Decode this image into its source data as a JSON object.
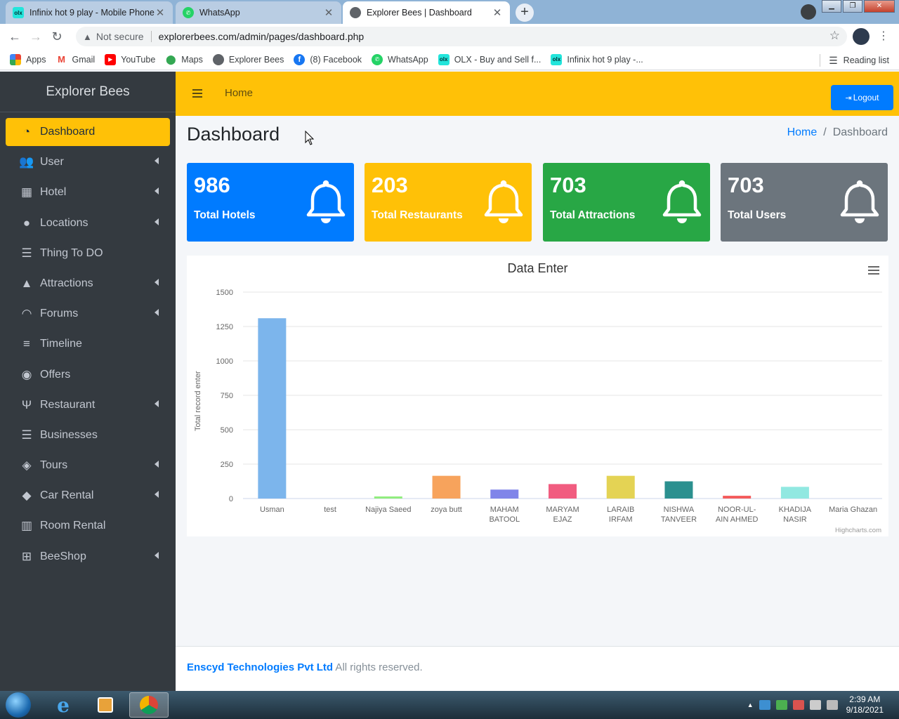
{
  "browser": {
    "tabs": [
      {
        "title": "Infinix hot 9 play - Mobile Phone",
        "favicon": "olx-icon"
      },
      {
        "title": "WhatsApp",
        "favicon": "whatsapp-icon"
      },
      {
        "title": "Explorer Bees | Dashboard",
        "favicon": "globe-icon"
      }
    ],
    "address": {
      "security": "Not secure",
      "url": "explorerbees.com/admin/pages/dashboard.php"
    },
    "bookmarks": [
      {
        "label": "Apps",
        "icon": "apps-grid-icon"
      },
      {
        "label": "Gmail",
        "icon": "gmail-icon"
      },
      {
        "label": "YouTube",
        "icon": "youtube-icon"
      },
      {
        "label": "Maps",
        "icon": "maps-icon"
      },
      {
        "label": "Explorer Bees",
        "icon": "globe-icon"
      },
      {
        "label": "(8) Facebook",
        "icon": "facebook-icon"
      },
      {
        "label": "WhatsApp",
        "icon": "whatsapp-icon"
      },
      {
        "label": "OLX - Buy and Sell f...",
        "icon": "olx-icon"
      },
      {
        "label": "Infinix hot 9 play -...",
        "icon": "olx-icon"
      }
    ],
    "reading_list": "Reading list"
  },
  "sidebar": {
    "brand": "Explorer Bees",
    "items": [
      {
        "label": "Dashboard",
        "icon": "dashboard-icon",
        "active": true
      },
      {
        "label": "User",
        "icon": "users-icon",
        "submenu": true
      },
      {
        "label": "Hotel",
        "icon": "hotel-icon",
        "submenu": true
      },
      {
        "label": "Locations",
        "icon": "map-marker-icon",
        "submenu": true
      },
      {
        "label": "Thing To DO",
        "icon": "list-icon"
      },
      {
        "label": "Attractions",
        "icon": "mountain-icon",
        "submenu": true
      },
      {
        "label": "Forums",
        "icon": "forum-icon",
        "submenu": true
      },
      {
        "label": "Timeline",
        "icon": "timeline-icon"
      },
      {
        "label": "Offers",
        "icon": "offers-icon"
      },
      {
        "label": "Restaurant",
        "icon": "utensils-icon",
        "submenu": true
      },
      {
        "label": "Businesses",
        "icon": "list-icon"
      },
      {
        "label": "Tours",
        "icon": "tours-icon",
        "submenu": true
      },
      {
        "label": "Car Rental",
        "icon": "car-icon",
        "submenu": true
      },
      {
        "label": "Room Rental",
        "icon": "building-icon"
      },
      {
        "label": "BeeShop",
        "icon": "cart-icon",
        "submenu": true
      }
    ]
  },
  "topnav": {
    "home": "Home",
    "logout": "Logout"
  },
  "page": {
    "title": "Dashboard",
    "breadcrumb": {
      "home": "Home",
      "current": "Dashboard"
    }
  },
  "stats": [
    {
      "value": "986",
      "label": "Total Hotels",
      "color": "#007bff"
    },
    {
      "value": "203",
      "label": "Total Restaurants",
      "color": "#ffc107"
    },
    {
      "value": "703",
      "label": "Total Attractions",
      "color": "#28a745"
    },
    {
      "value": "703",
      "label": "Total Users",
      "color": "#6c757d"
    }
  ],
  "chart_data": {
    "type": "bar",
    "title": "Data Enter",
    "xlabel": "",
    "ylabel": "Total record enter",
    "ylim": [
      0,
      1500
    ],
    "yticks": [
      0,
      250,
      500,
      750,
      1000,
      1250,
      1500
    ],
    "categories": [
      "Usman",
      "test",
      "Najiya Saeed",
      "zoya butt",
      "MAHAM BATOOL",
      "MARYAM EJAZ",
      "LARAIB IRFAM",
      "NISHWA TANVEER",
      "NOOR-UL-AIN AHMED",
      "KHADIJA NASIR",
      "Maria Ghazan"
    ],
    "category_lines": [
      [
        "Usman"
      ],
      [
        "test"
      ],
      [
        "Najiya Saeed"
      ],
      [
        "zoya butt"
      ],
      [
        "MAHAM",
        "BATOOL"
      ],
      [
        "MARYAM",
        "EJAZ"
      ],
      [
        "LARAIB",
        "IRFAM"
      ],
      [
        "NISHWA",
        "TANVEER"
      ],
      [
        "NOOR-UL-",
        "AIN AHMED"
      ],
      [
        "KHADIJA",
        "NASIR"
      ],
      [
        "Maria Ghazan"
      ]
    ],
    "values": [
      1310,
      0,
      15,
      165,
      65,
      105,
      165,
      125,
      20,
      85,
      0
    ],
    "colors": [
      "#7cb5ec",
      "#434348",
      "#90ed7d",
      "#f7a35c",
      "#8085e9",
      "#f15c80",
      "#e4d354",
      "#2b908f",
      "#f45b5b",
      "#91e8e1",
      "#7cb5ec"
    ],
    "grid": true,
    "legend": "none",
    "credits": "Highcharts.com"
  },
  "footer": {
    "company": "Enscyd Technologies Pvt Ltd",
    "rights": " All rights reserved."
  },
  "taskbar": {
    "time": "2:39 AM",
    "date": "9/18/2021"
  }
}
